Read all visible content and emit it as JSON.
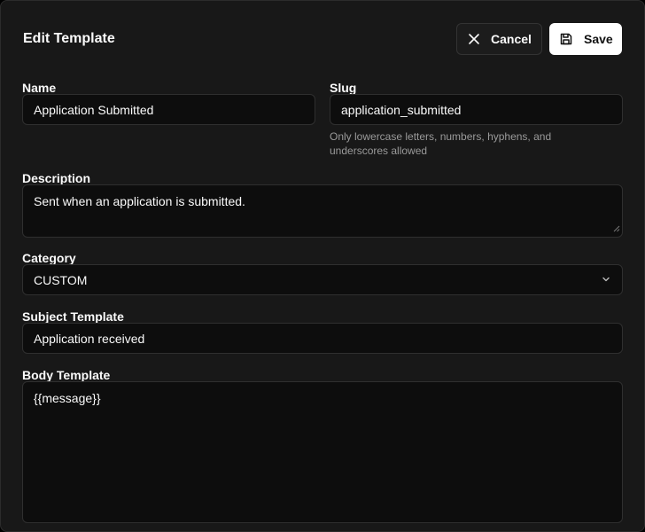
{
  "header": {
    "title": "Edit Template",
    "cancel_label": "Cancel",
    "save_label": "Save"
  },
  "form": {
    "name": {
      "label": "Name",
      "value": "Application Submitted"
    },
    "slug": {
      "label": "Slug",
      "value": "application_submitted",
      "hint": "Only lowercase letters, numbers, hyphens, and underscores allowed"
    },
    "description": {
      "label": "Description",
      "value": "Sent when an application is submitted."
    },
    "category": {
      "label": "Category",
      "value": "CUSTOM"
    },
    "subject": {
      "label": "Subject Template",
      "value": "Application received"
    },
    "body": {
      "label": "Body Template",
      "value": "{{message}}"
    }
  },
  "colors": {
    "panel_bg": "#181818",
    "field_bg": "#0d0d0d",
    "save_bg": "#ffffff"
  }
}
